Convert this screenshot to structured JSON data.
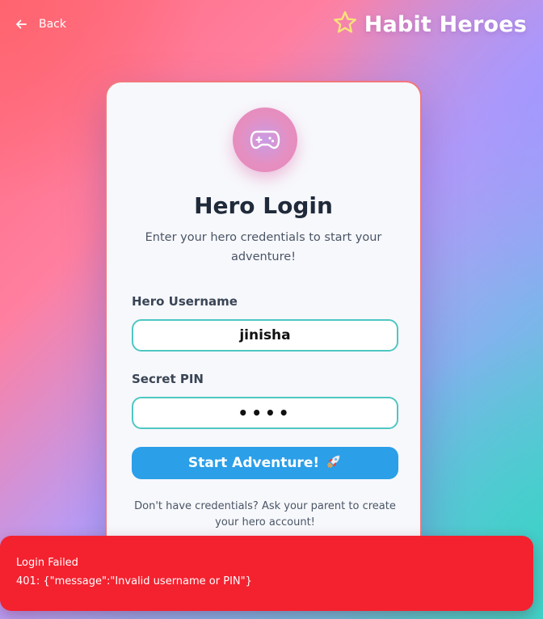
{
  "nav": {
    "back_label": "Back",
    "back_icon": "arrow-left-icon"
  },
  "brand": {
    "title": "Habit Heroes",
    "icon": "star-icon",
    "star_color": "#f9e37a"
  },
  "login": {
    "avatar_icon": "gamepad-icon",
    "title": "Hero Login",
    "subtitle": "Enter your hero credentials to start your adventure!",
    "username_label": "Hero Username",
    "username_value": "jinisha",
    "pin_label": "Secret PIN",
    "pin_value": "••••",
    "submit_label": "Start Adventure!",
    "submit_icon": "rocket-icon",
    "help_text": "Don't have credentials? Ask your parent to create your hero account!"
  },
  "toast": {
    "title": "Login Failed",
    "message": "401: {\"message\":\"Invalid username or PIN\"}",
    "color": "#f4212f"
  },
  "colors": {
    "accent": "#2b9fe8",
    "input_border": "#4ec7c2",
    "card_border": "#f2777c"
  }
}
